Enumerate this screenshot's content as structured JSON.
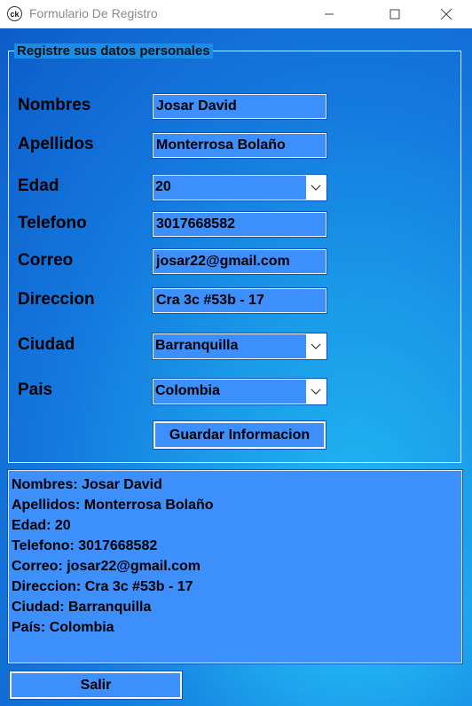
{
  "window": {
    "title": "Formulario De Registro",
    "icon": "app-icon",
    "icon_glyph": "ck"
  },
  "form": {
    "legend": "Registre sus datos personales",
    "labels": {
      "nombres": "Nombres",
      "apellidos": "Apellidos",
      "edad": "Edad",
      "telefono": "Telefono",
      "correo": "Correo",
      "direccion": "Direccion",
      "ciudad": "Ciudad",
      "pais": "Pais"
    },
    "values": {
      "nombres": "Josar David",
      "apellidos": "Monterrosa Bolaño",
      "edad": "20",
      "telefono": "3017668582",
      "correo": "josar22@gmail.com",
      "direccion": "Cra 3c #53b - 17",
      "ciudad": "Barranquilla",
      "pais": "Colombia"
    },
    "save_label": "Guardar Informacion"
  },
  "output": {
    "lines": [
      "Nombres: Josar David",
      "Apellidos: Monterrosa Bolaño",
      "Edad: 20",
      "Telefono: 3017668582",
      "Correo: josar22@gmail.com",
      "Direccion: Cra 3c #53b - 17",
      "Ciudad: Barranquilla",
      "País: Colombia"
    ]
  },
  "exit_label": "Salir",
  "colors": {
    "field_bg": "#3d8ffb",
    "background_start": "#0d5cc8",
    "background_glow": "#20b4f2"
  }
}
